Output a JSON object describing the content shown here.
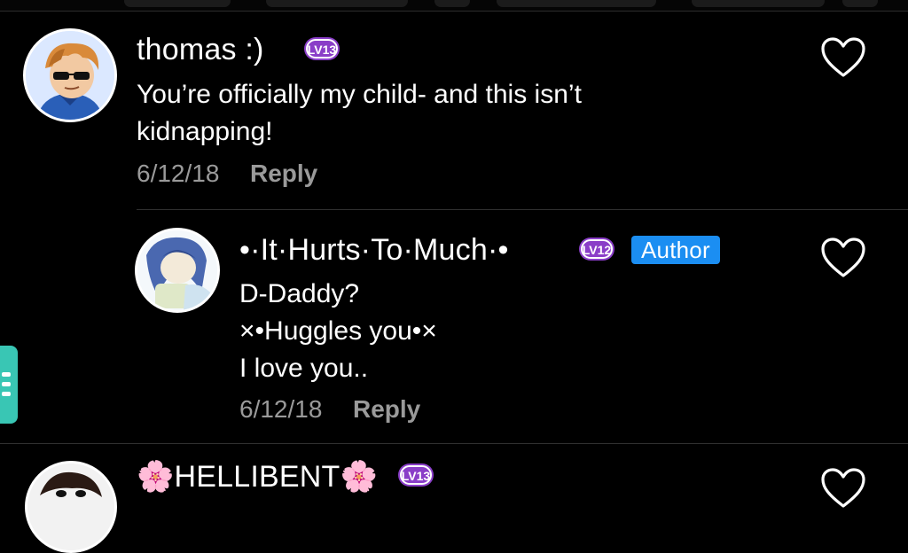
{
  "comments": [
    {
      "username": "thomas :)",
      "level": "LV13",
      "text": "You’re officially my child- and this isn’t\nkidnapping!",
      "date": "6/12/18",
      "reply_label": "Reply",
      "avatar_icon": "cartoon-boy-sunglasses-avatar",
      "like_icon": "heart-outline-icon"
    },
    {
      "username": "•·It·Hurts·To·Much·•",
      "level": "LV12",
      "badge": "Author",
      "text": "D-Daddy?\n×•Huggles you•×\nI love you..",
      "date": "6/12/18",
      "reply_label": "Reply",
      "avatar_icon": "anime-girl-avatar",
      "like_icon": "heart-outline-icon"
    },
    {
      "username": "🌸HELLIBENT🌸",
      "level": "LV13",
      "avatar_icon": "cartoon-avatar",
      "like_icon": "heart-outline-icon"
    }
  ],
  "colors": {
    "background": "#000000",
    "level_badge": "#8a3ec8",
    "author_badge": "#1b8ef2",
    "meta_text": "#9a9a9a",
    "side_tab": "#39c6b4"
  },
  "side_tab_icon": "menu-lines-icon"
}
